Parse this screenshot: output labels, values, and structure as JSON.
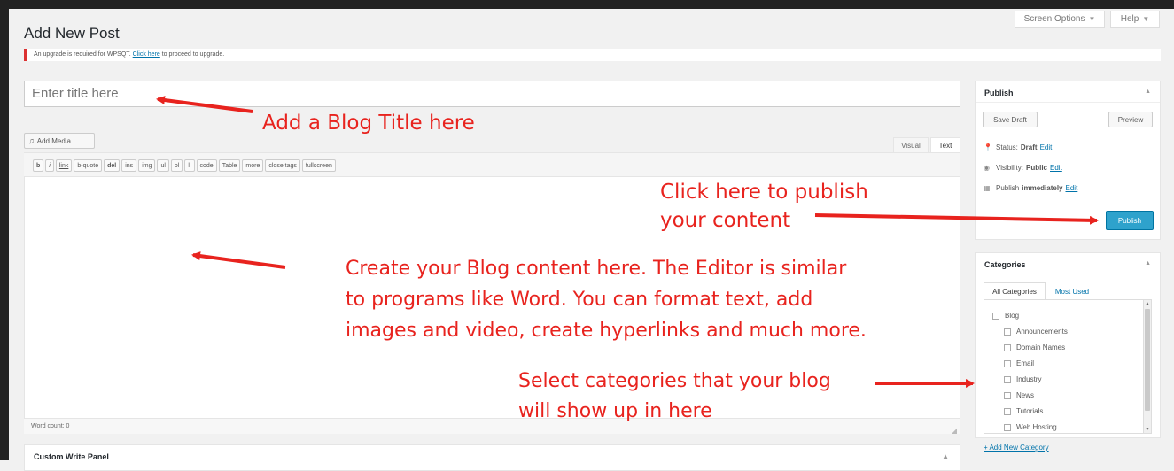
{
  "header": {
    "page_title": "Add New Post",
    "screen_options": "Screen Options",
    "help": "Help"
  },
  "notice": {
    "text_before": "An upgrade is required for WPSQT. ",
    "link": "Click here",
    "text_after": " to proceed to upgrade."
  },
  "editor": {
    "title_placeholder": "Enter title here",
    "add_media_label": "Add Media",
    "visual_tab": "Visual",
    "text_tab": "Text",
    "quicktags": [
      "b",
      "i",
      "link",
      "b-quote",
      "del",
      "ins",
      "img",
      "ul",
      "ol",
      "li",
      "code",
      "Table",
      "more",
      "close tags",
      "fullscreen"
    ],
    "word_count": "Word count: 0"
  },
  "custom_panel": {
    "title": "Custom Write Panel"
  },
  "publish_box": {
    "title": "Publish",
    "save_draft": "Save Draft",
    "preview": "Preview",
    "status_label": "Status:",
    "status_value": "Draft",
    "visibility_label": "Visibility:",
    "visibility_value": "Public",
    "publish_label": "Publish",
    "publish_value": "immediately",
    "edit_link": "Edit",
    "publish_button": "Publish"
  },
  "categories_box": {
    "title": "Categories",
    "tab_all": "All Categories",
    "tab_most_used": "Most Used",
    "items": [
      {
        "label": "Blog",
        "level": 0
      },
      {
        "label": "Announcements",
        "level": 1
      },
      {
        "label": "Domain Names",
        "level": 1
      },
      {
        "label": "Email",
        "level": 1
      },
      {
        "label": "Industry",
        "level": 1
      },
      {
        "label": "News",
        "level": 1
      },
      {
        "label": "Tutorials",
        "level": 1
      },
      {
        "label": "Web Hosting",
        "level": 1
      }
    ],
    "add_new": "+ Add New Category"
  },
  "annotations": {
    "title_hint": "Add a Blog Title here",
    "publish_hint_1": "Click here to publish",
    "publish_hint_2": "your content",
    "content_hint_1": "Create your Blog content here. The Editor is similar",
    "content_hint_2": "to programs like Word. You can format text, add",
    "content_hint_3": "images and video, create hyperlinks and much more.",
    "category_hint_1": "Select categories that your blog",
    "category_hint_2": "will show up in here"
  },
  "colors": {
    "annotation_red": "#e8231e",
    "publish_blue": "#2ea2cc",
    "link_blue": "#0073aa",
    "notice_red": "#dc3232"
  }
}
